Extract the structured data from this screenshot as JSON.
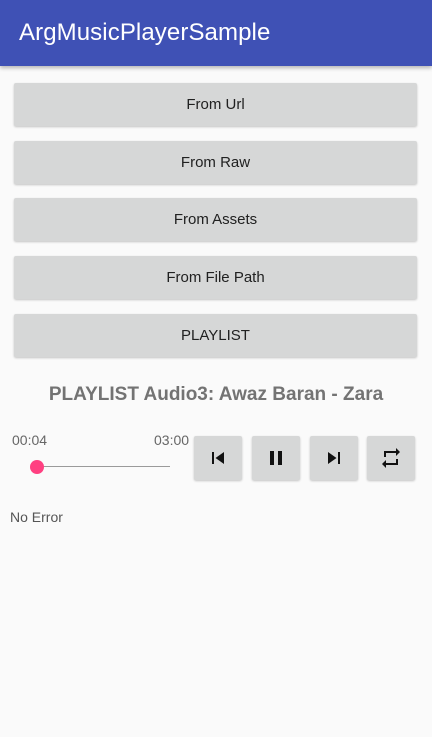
{
  "app": {
    "title": "ArgMusicPlayerSample"
  },
  "buttons": {
    "from_url": "From Url",
    "from_raw": "From Raw",
    "from_assets": "From Assets",
    "from_file_path": "From File Path",
    "playlist": "PLAYLIST"
  },
  "player": {
    "now_playing": "PLAYLIST Audio3: Awaz Baran - Zara",
    "elapsed": "00:04",
    "duration": "03:00",
    "progress_fraction": 0.022,
    "controls": [
      "skip-previous-icon",
      "pause-icon",
      "skip-next-icon",
      "repeat-icon"
    ]
  },
  "status": {
    "error": "No Error"
  },
  "colors": {
    "appbar": "#3f51b5",
    "accent": "#ff4081",
    "button": "#d6d7d7",
    "background": "#fafafa"
  }
}
